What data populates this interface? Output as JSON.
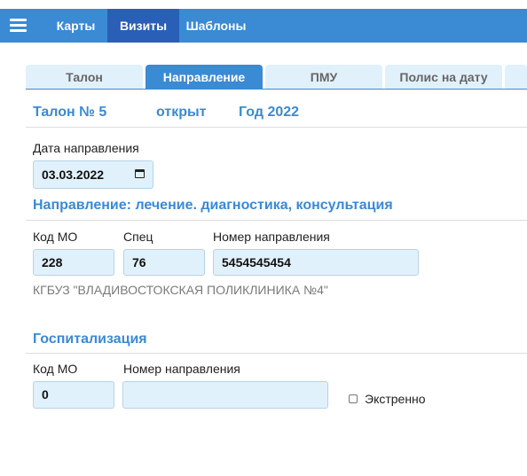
{
  "nav": {
    "items": [
      {
        "label": "Карты"
      },
      {
        "label": "Визиты"
      },
      {
        "label": "Шаблоны"
      }
    ],
    "active": "Визиты"
  },
  "tabs": [
    {
      "label": "Талон"
    },
    {
      "label": "Направление"
    },
    {
      "label": "ПМУ"
    },
    {
      "label": "Полис на дату"
    }
  ],
  "active_tab": "Направление",
  "talon": {
    "title": "Талон № 5",
    "status": "открыт",
    "year": "Год 2022"
  },
  "referral_date": {
    "label": "Дата направления",
    "value": "03.03.2022"
  },
  "referral": {
    "section_title": "Направление: лечение. диагностика, консультация",
    "mo_label": "Код МО",
    "mo_value": "228",
    "spec_label": "Спец",
    "spec_value": "76",
    "number_label": "Номер направления",
    "number_value": "5454545454",
    "org_name": "КГБУЗ \"ВЛАДИВОСТОКСКАЯ ПОЛИКЛИНИКА №4\""
  },
  "hospitalization": {
    "section_title": "Госпитализация",
    "mo_label": "Код МО",
    "mo_value": "0",
    "number_label": "Номер направления",
    "number_value": "",
    "urgent_label": "Экстренно",
    "urgent_checked": false
  },
  "colors": {
    "topbar": "#3a8ad4",
    "nav_active": "#2a5fb8",
    "field_bg": "#e1f1fb",
    "accent_text": "#3a8ad4"
  },
  "icons": {
    "menu": "hamburger-icon",
    "date_picker": "calendar-icon"
  }
}
